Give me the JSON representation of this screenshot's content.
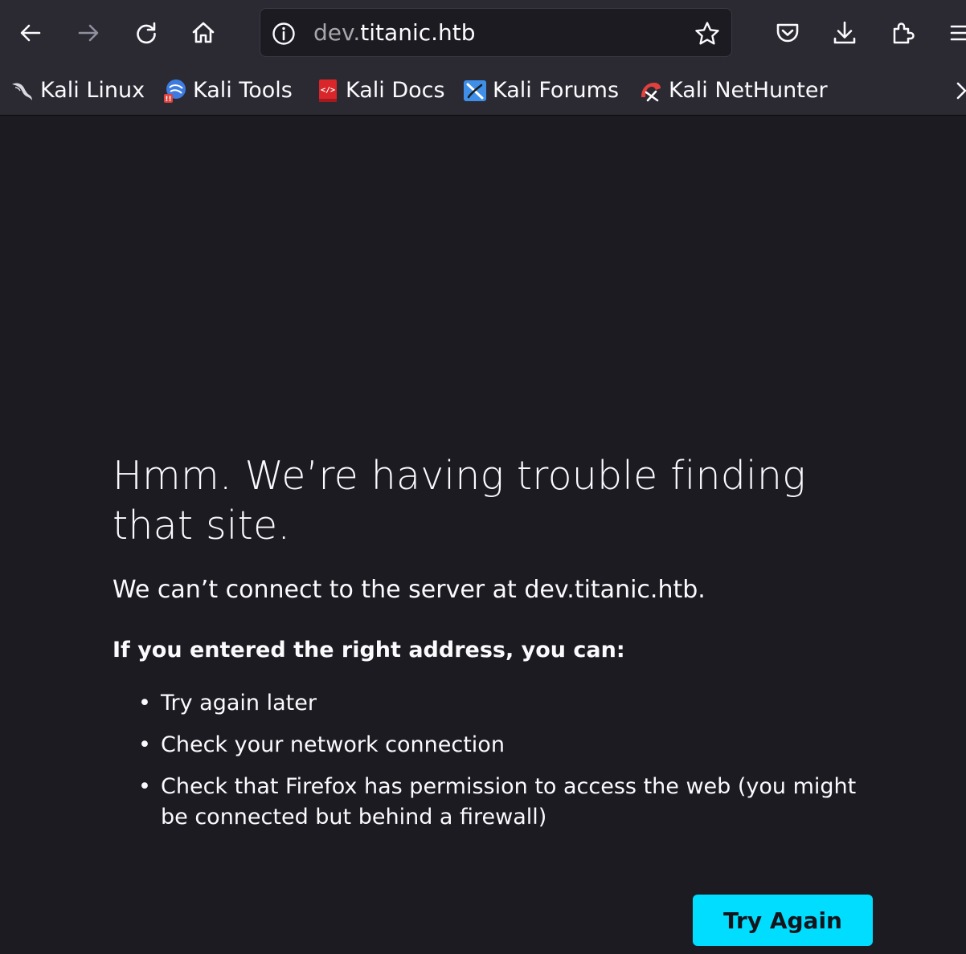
{
  "toolbar": {
    "back_icon": "arrow-left-icon",
    "forward_icon": "arrow-right-icon",
    "reload_icon": "reload-icon",
    "home_icon": "home-icon",
    "pocket_icon": "pocket-icon",
    "downloads_icon": "download-icon",
    "extensions_icon": "extensions-icon",
    "menu_icon": "hamburger-menu-icon"
  },
  "urlbar": {
    "url_prefix": "dev.",
    "url_main": "titanic.htb",
    "info_icon": "info-icon",
    "bookmark_icon": "star-icon"
  },
  "bookmarks": [
    {
      "label": "Kali Linux",
      "icon": "kali-dragon-icon"
    },
    {
      "label": "Kali Tools",
      "icon": "kali-tools-icon"
    },
    {
      "label": "Kali Docs",
      "icon": "kali-docs-icon"
    },
    {
      "label": "Kali Forums",
      "icon": "kali-forums-icon"
    },
    {
      "label": "Kali NetHunter",
      "icon": "kali-nethunter-icon"
    }
  ],
  "error": {
    "title": "Hmm. We’re having trouble finding that site.",
    "description": "We can’t connect to the server at dev.titanic.htb.",
    "subtitle": "If you entered the right address, you can:",
    "suggestions": [
      "Try again later",
      "Check your network connection",
      "Check that Firefox has permission to access the web (you might be connected but behind a firewall)"
    ],
    "try_again_label": "Try Again"
  },
  "colors": {
    "chrome_bg": "#2b2a33",
    "page_bg": "#1c1b22",
    "accent": "#00ddff",
    "text": "#fbfbfe"
  }
}
